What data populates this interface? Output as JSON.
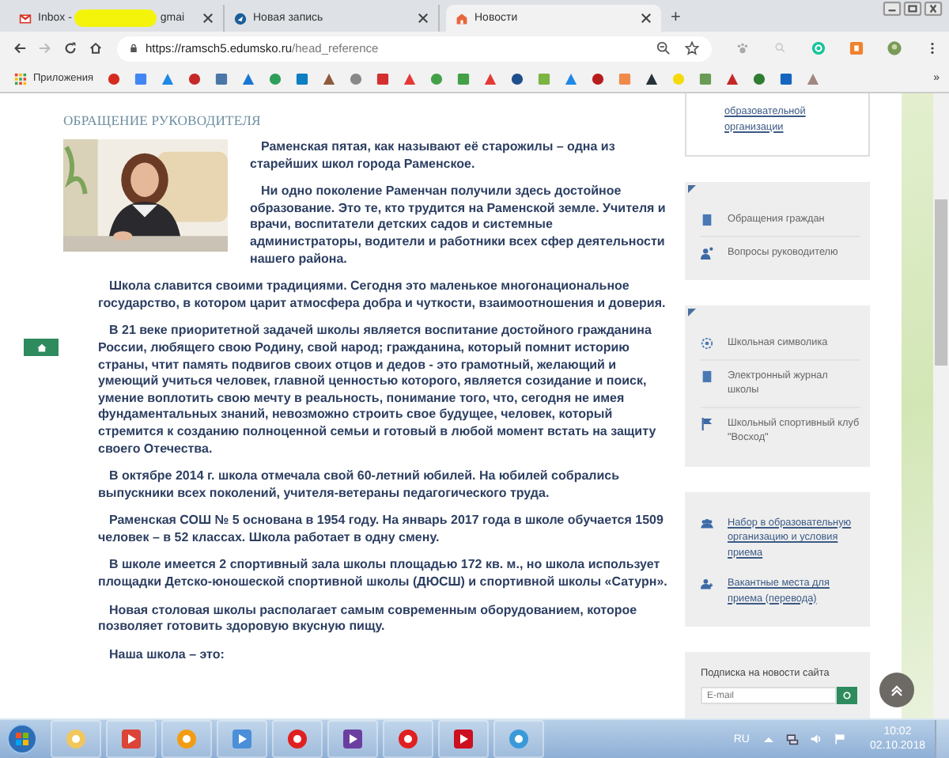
{
  "browser": {
    "tabs": [
      {
        "title": "Inbox -",
        "title_tail": "gmai",
        "redacted": true,
        "kind": "mail",
        "selected": false
      },
      {
        "title": "Новая запись",
        "redacted": false,
        "kind": "bird",
        "selected": false
      },
      {
        "title": "Новости",
        "redacted": false,
        "kind": "news",
        "selected": true
      }
    ],
    "new_tab": "+",
    "address": {
      "host": "https://ramsch5.edumsko.ru",
      "path": "/head_reference"
    },
    "bookmarks": {
      "apps_label": "Приложения",
      "more": "»"
    }
  },
  "page": {
    "heading": "ОБРАЩЕНИЕ РУКОВОДИТЕЛЯ",
    "paragraphs": [
      "Раменская пятая, как называют её старожилы – одна из старейших школ города Раменское.",
      "Ни одно поколение Раменчан получили здесь достойное образование. Это те, кто трудится на Раменской земле. Учителя и врачи, воспитатели детских садов и системные администраторы, водители и работники всех сфер деятельности нашего района.",
      "Школа славится своими традициями. Сегодня это маленькое многонациональное государство, в котором царит атмосфера добра и чуткости, взаимоотношения и доверия.",
      "В 21 веке приоритетной задачей школы является воспитание достойного гражданина России, любящего свою Родину, свой народ; гражданина,  который помнит историю страны, чтит память подвигов своих отцов и дедов - это грамотный, желающий  и умеющий учиться человек, главной ценностью которого, является созидание и поиск, умение воплотить свою мечту в реальность, понимание того, что, сегодня не имея фундаментальных знаний, невозможно строить свое будущее, человек, который стремится к созданию полноценной семьи и готовый в любой момент встать на защиту своего Отечества.",
      "В октябре 2014 г. школа отмечала свой 60-летний юбилей. На юбилей собрались выпускники всех поколений, учителя-ветераны педагогического труда.",
      "Раменская СОШ № 5 основана в 1954 году. На январь 2017 года в школе обучается 1509 человек – в 52 классах. Школа работает в одну смену.",
      "В школе имеется 2 спортивный зала школы площадью 172 кв. м., но школа использует площадки  Детско-юношеской спортивной школы (ДЮСШ)  и спортивной школы «Сатурн».",
      "Новая столовая школы располагает самым современным оборудованием, которое позволяет готовить здоровую вкусную пищу.",
      "Наша школа – это:"
    ]
  },
  "sidebar": {
    "panels": [
      {
        "kind": "links",
        "items": [
          {
            "text": "образовательной организации",
            "kind": "none"
          }
        ]
      },
      {
        "kind": "menu",
        "items": [
          {
            "text": "Обращения граждан",
            "kind": "document"
          },
          {
            "text": "Вопросы руководителю",
            "kind": "person"
          }
        ]
      },
      {
        "kind": "menu",
        "items": [
          {
            "text": "Школьная символика",
            "kind": "emblem"
          },
          {
            "text": "Электронный журнал школы",
            "kind": "document"
          },
          {
            "text": "Школьный спортивный клуб \"Восход\"",
            "kind": "flag"
          }
        ]
      },
      {
        "kind": "links",
        "items": [
          {
            "text": "Набор в образовательную организацию и условия приема",
            "kind": "group"
          },
          {
            "text": "Вакантные места для приема (перевода)",
            "kind": "person_add"
          }
        ]
      }
    ],
    "subscribe": {
      "title": "Подписка на новости сайта",
      "placeholder": "E-mail"
    }
  },
  "taskbar": {
    "language": "RU",
    "time": "10:02",
    "date": "02.10.2018"
  }
}
